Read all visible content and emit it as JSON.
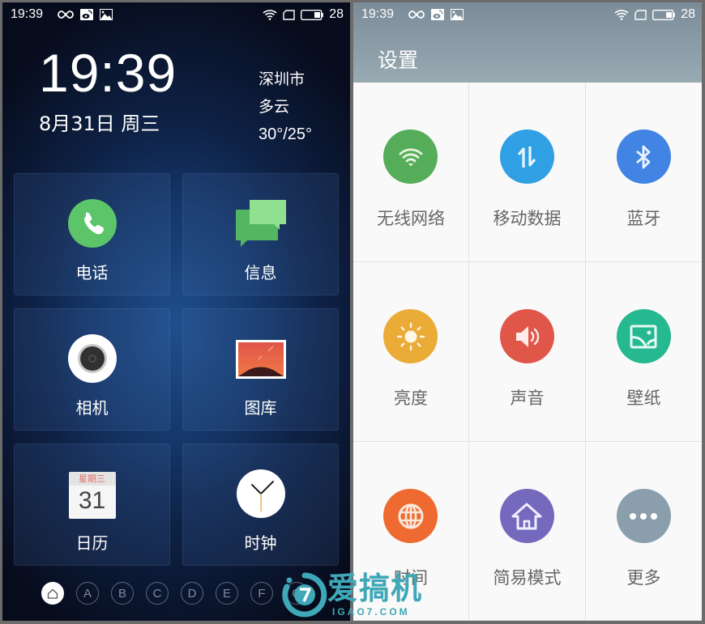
{
  "left_screen": {
    "status_bar": {
      "time": "19:39",
      "left_icons": [
        "infinity-icon",
        "weibo-icon",
        "image-icon"
      ],
      "right_icons": [
        "wifi-icon",
        "sim-icon",
        "battery-icon"
      ],
      "battery": "28"
    },
    "clock": {
      "time": "19:39",
      "date": "8月31日 周三"
    },
    "weather": {
      "city": "深圳市",
      "condition": "多云",
      "temperature": "30°/25°"
    },
    "apps": [
      {
        "label": "电话",
        "icon": "phone-icon",
        "color": "#5cc56a"
      },
      {
        "label": "信息",
        "icon": "message-icon",
        "color": "#5cc56a"
      },
      {
        "label": "相机",
        "icon": "camera-icon",
        "color": "#ffffff"
      },
      {
        "label": "图库",
        "icon": "gallery-icon",
        "color": "#e1553f"
      },
      {
        "label": "日历",
        "icon": "calendar-icon",
        "color": "#f5f5f5",
        "weekday": "星期三",
        "day": "31"
      },
      {
        "label": "时钟",
        "icon": "clock-icon",
        "color": "#ffffff"
      }
    ],
    "pager": {
      "home_icon": "home-icon",
      "pages": [
        "A",
        "B",
        "C",
        "D",
        "E",
        "F",
        "G"
      ],
      "active": "home"
    }
  },
  "right_screen": {
    "status_bar": {
      "time": "19:39",
      "left_icons": [
        "infinity-icon",
        "weibo-icon",
        "image-icon"
      ],
      "right_icons": [
        "wifi-icon",
        "sim-icon",
        "battery-icon"
      ],
      "battery": "28"
    },
    "title": "设置",
    "items": [
      {
        "label": "无线网络",
        "icon": "wifi-icon",
        "color": "#55ad5a"
      },
      {
        "label": "移动数据",
        "icon": "mobile-data-icon",
        "color": "#2ea0e3"
      },
      {
        "label": "蓝牙",
        "icon": "bluetooth-icon",
        "color": "#4184e3"
      },
      {
        "label": "亮度",
        "icon": "brightness-icon",
        "color": "#ebab37"
      },
      {
        "label": "声音",
        "icon": "sound-icon",
        "color": "#e0574a"
      },
      {
        "label": "壁纸",
        "icon": "wallpaper-icon",
        "color": "#26b890"
      },
      {
        "label": "时间",
        "icon": "globe-icon",
        "color": "#ee6a30"
      },
      {
        "label": "简易模式",
        "icon": "home-icon",
        "color": "#7469bd"
      },
      {
        "label": "更多",
        "icon": "more-icon",
        "color": "#8a9eab"
      }
    ]
  },
  "watermark": {
    "text": "爱搞机",
    "sub": "IGAO7.COM",
    "color": "#3fa7b7"
  }
}
